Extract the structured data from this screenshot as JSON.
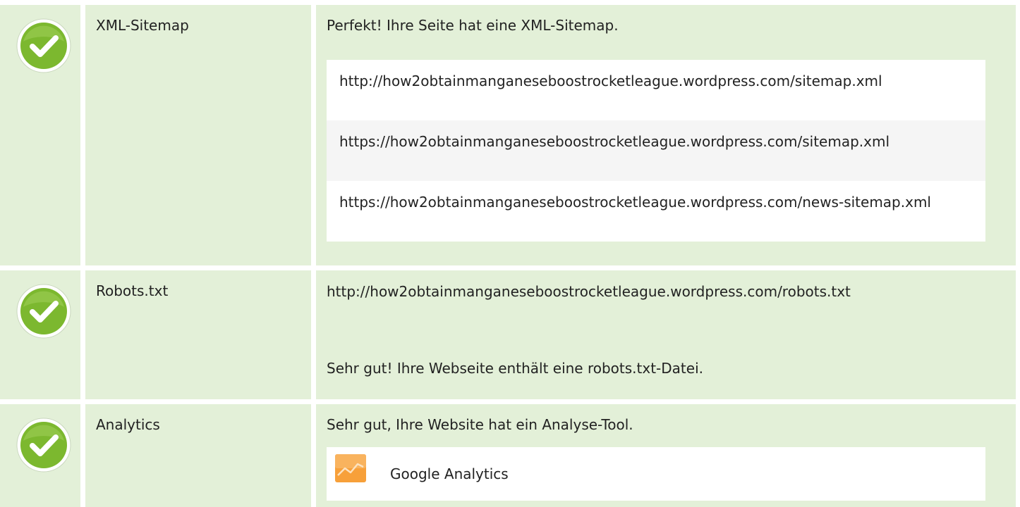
{
  "rows": [
    {
      "label": "XML-Sitemap",
      "message": "Perfekt! Ihre Seite hat eine XML-Sitemap.",
      "urls": [
        "http://how2obtainmanganeseboostrocketleague.wordpress.com/sitemap.xml",
        "https://how2obtainmanganeseboostrocketleague.wordpress.com/sitemap.xml",
        "https://how2obtainmanganeseboostrocketleague.wordpress.com/news-sitemap.xml"
      ],
      "status_icon": "check-circle-icon"
    },
    {
      "label": "Robots.txt",
      "url": "http://how2obtainmanganeseboostrocketleague.wordpress.com/robots.txt",
      "message": "Sehr gut! Ihre Webseite enthält eine robots.txt-Datei.",
      "status_icon": "check-circle-icon"
    },
    {
      "label": "Analytics",
      "message": "Sehr gut, Ihre Website hat ein Analyse-Tool.",
      "tools": [
        {
          "name": "Google Analytics",
          "icon": "google-analytics-icon"
        }
      ],
      "status_icon": "check-circle-icon"
    }
  ],
  "colors": {
    "row_background": "#e3f0d8",
    "check_green": "#7cb82f",
    "analytics_orange": "#f7a03a"
  }
}
